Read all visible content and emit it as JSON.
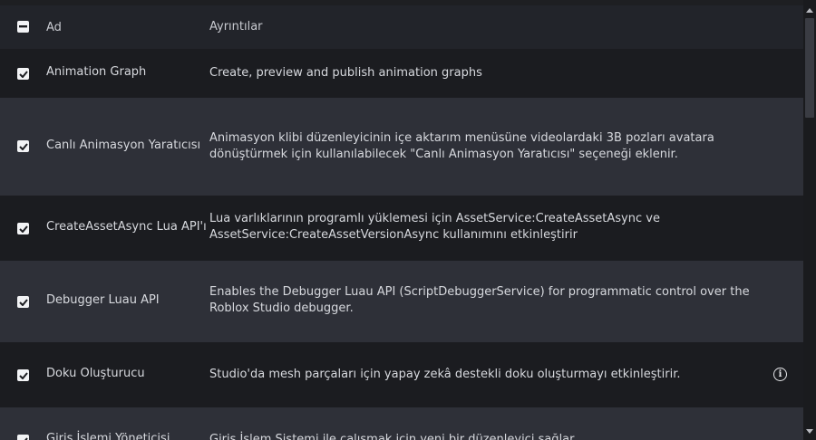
{
  "header": {
    "name_col": "Ad",
    "details_col": "Ayrıntılar"
  },
  "rows": [
    {
      "name": "Animation Graph",
      "details": "Create, preview and publish animation graphs"
    },
    {
      "name": "Canlı Animasyon Yaratıcısı",
      "details": "Animasyon klibi düzenleyicinin içe aktarım menüsüne videolardaki 3B pozları avatara dönüştürmek için kullanılabilecek \"Canlı Animasyon Yaratıcısı\" seçeneği eklenir."
    },
    {
      "name": "CreateAssetAsync Lua API'ı",
      "details": "Lua varlıklarının programlı yüklemesi için AssetService:CreateAssetAsync ve AssetService:CreateAssetVersionAsync kullanımını etkinleştirir"
    },
    {
      "name": "Debugger Luau API",
      "details": "Enables the Debugger Luau API (ScriptDebuggerService) for programmatic control over the Roblox Studio debugger."
    },
    {
      "name": "Doku Oluşturucu",
      "details": "Studio'da mesh parçaları için yapay zekâ destekli doku oluşturmayı etkinleştirir."
    },
    {
      "name": "Giriş İşlemi Yöneticisi",
      "details": "Giriş İşlem Sistemi ile çalışmak için yeni bir düzenleyici sağlar"
    }
  ],
  "icons": {
    "info": "info-icon",
    "header_checkbox": "indeterminate-checkbox-icon",
    "row_checkbox": "checked-checkbox-icon"
  }
}
